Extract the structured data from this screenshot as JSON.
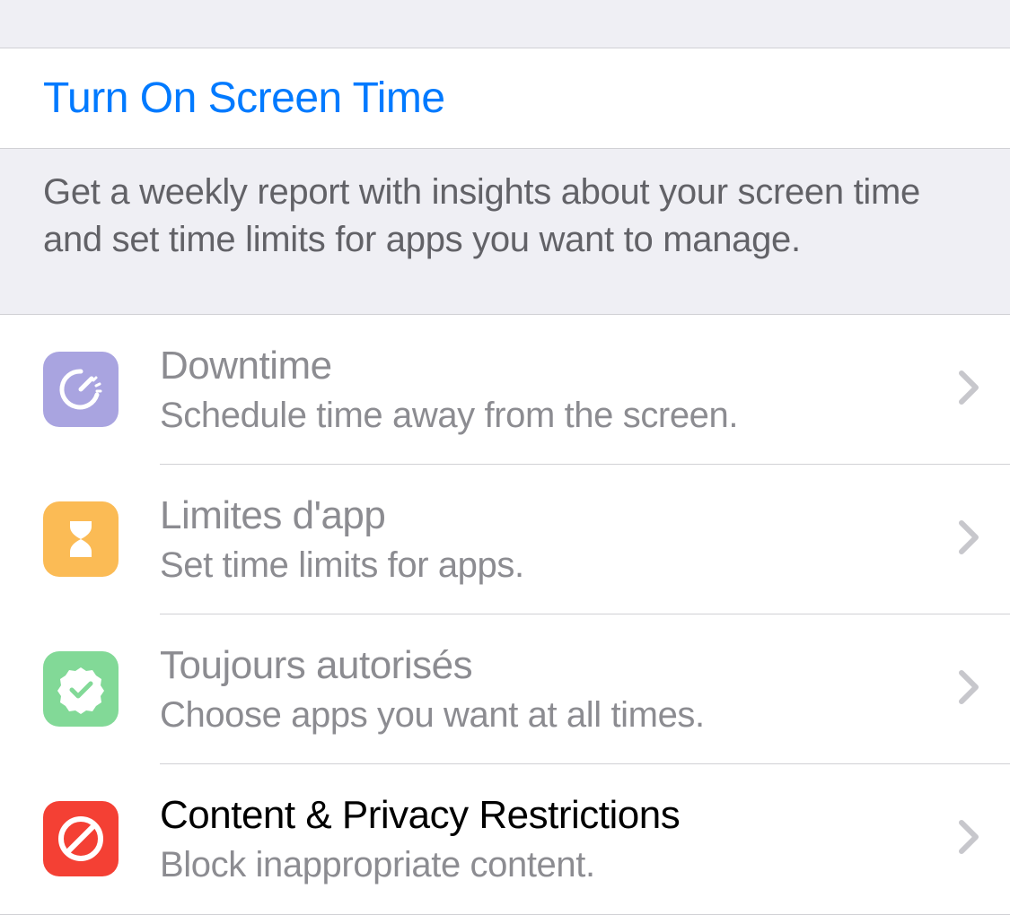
{
  "header": {
    "turn_on_label": "Turn On Screen Time"
  },
  "description": "Get a weekly report with insights about your screen time and set time limits for apps you want to manage.",
  "rows": [
    {
      "title": "Downtime",
      "subtitle": "Schedule time away from the screen.",
      "icon": "speedometer",
      "color": "purple",
      "disabled": true
    },
    {
      "title": "Limites d'app",
      "subtitle": "Set time limits for apps.",
      "icon": "hourglass",
      "color": "orange",
      "disabled": true
    },
    {
      "title": "Toujours autorisés",
      "subtitle": "Choose apps you want at all times.",
      "icon": "checkmark-seal",
      "color": "green",
      "disabled": true
    },
    {
      "title": "Content & Privacy Restrictions",
      "subtitle": "Block inappropriate content.",
      "icon": "no-sign",
      "color": "red",
      "disabled": false
    }
  ]
}
